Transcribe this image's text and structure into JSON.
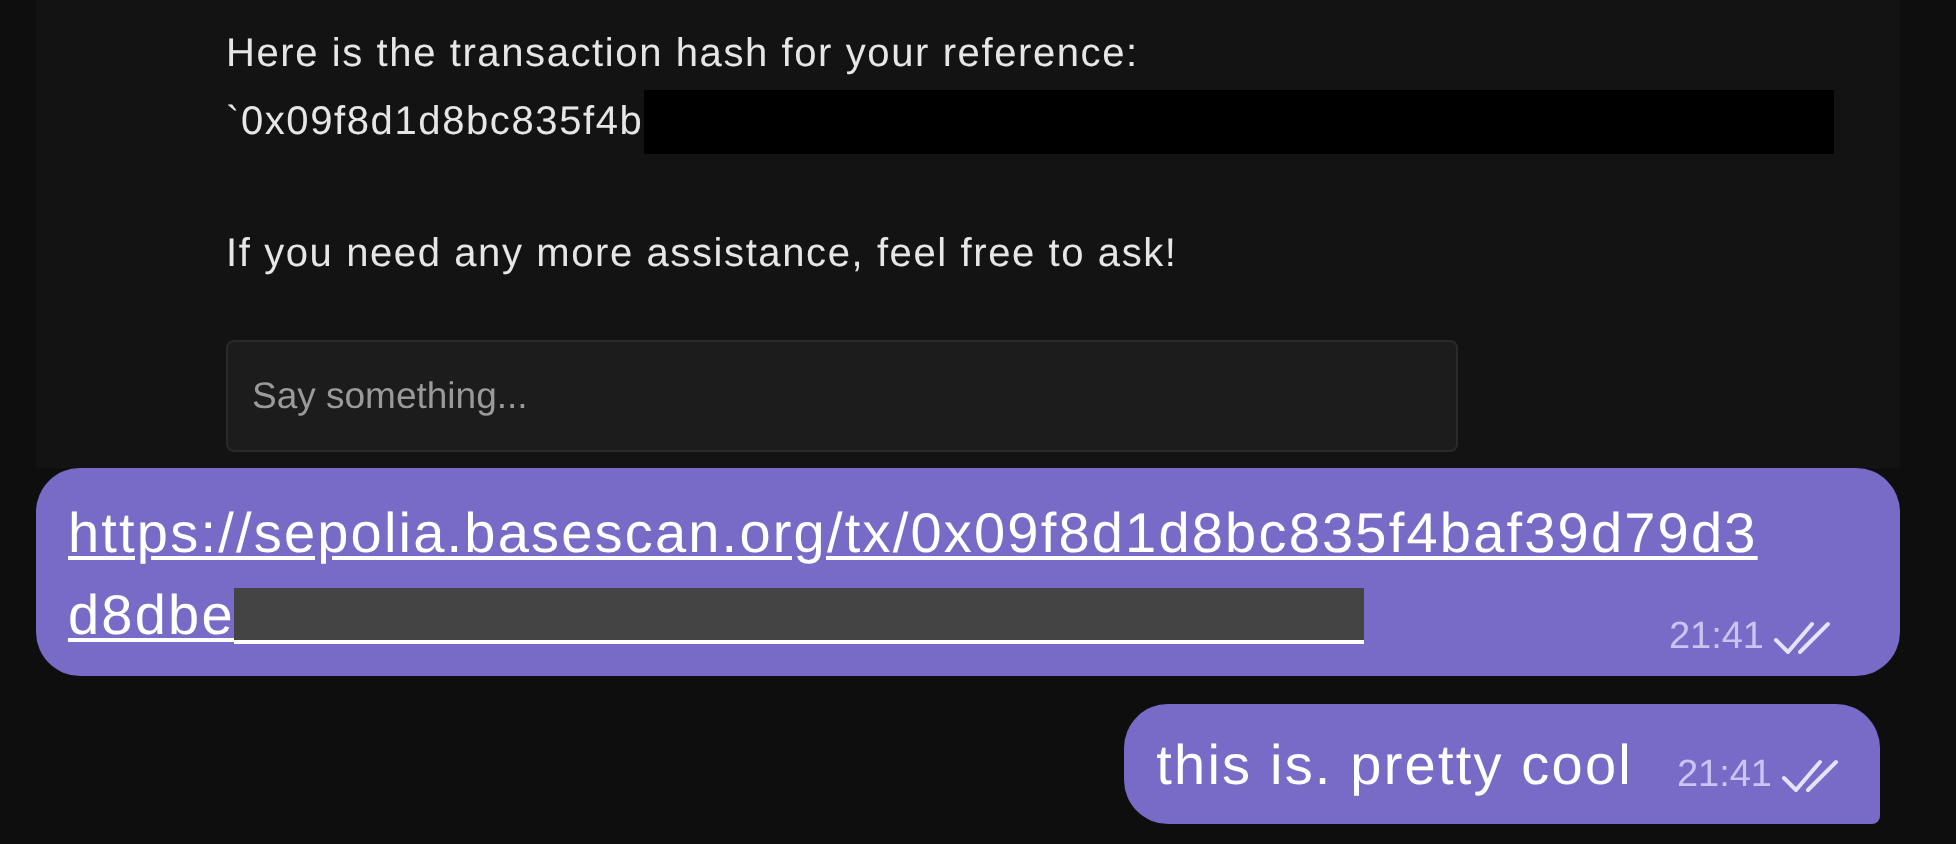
{
  "embedded_chat": {
    "lines": [
      {
        "text": "Here is the transaction hash for your reference:",
        "redacted": false
      },
      {
        "text": "`0x09f8d1d8bc835f4b",
        "redacted": true
      },
      {
        "text": "If you need any more assistance, feel free to ask!",
        "redacted": false
      }
    ],
    "input": {
      "placeholder": "Say something..."
    }
  },
  "messages": [
    {
      "kind": "link",
      "lines": [
        "https://sepolia.basescan.org/tx/0x09f8d1d8bc835f4baf39d79d3",
        "d8dbe"
      ],
      "redacted": true,
      "time": "21:41",
      "read": true,
      "tail": false
    },
    {
      "kind": "text",
      "text": "this is. pretty cool",
      "redacted": false,
      "time": "21:41",
      "read": true,
      "tail": true
    }
  ]
}
